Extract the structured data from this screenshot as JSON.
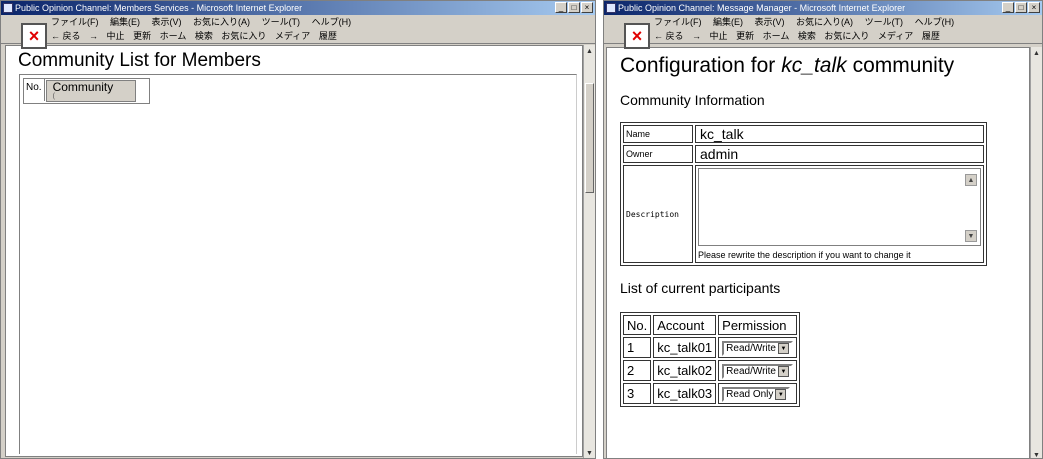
{
  "left_window": {
    "title": "Public Opinion Channel: Members Services - Microsoft Internet Explorer",
    "controls": [
      "_",
      "□",
      "×"
    ],
    "menu": [
      "ファイル(F)",
      "編集(E)",
      "表示(V)",
      "お気に入り(A)",
      "ツール(T)",
      "ヘルプ(H)"
    ],
    "toolbar": [
      "← 戻る",
      "→",
      "中止",
      "更新",
      "ホーム",
      "検索",
      "お気に入り",
      "メディア",
      "履歴"
    ],
    "page_title": "Community List for Members",
    "table": {
      "headers": [
        "No.",
        "Community"
      ],
      "sort_hint": "("
    }
  },
  "right_window": {
    "title": "Public Opinion Channel: Message Manager - Microsoft Internet Explorer",
    "controls": [
      "_",
      "□",
      "×"
    ],
    "menu": [
      "ファイル(F)",
      "編集(E)",
      "表示(V)",
      "お気に入り(A)",
      "ツール(T)",
      "ヘルプ(H)"
    ],
    "toolbar": [
      "← 戻る",
      "→",
      "中止",
      "更新",
      "ホーム",
      "検索",
      "お気に入り",
      "メディア",
      "履歴"
    ],
    "page_title_prefix": "Configuration for",
    "page_title_name": "kc_talk",
    "page_title_suffix": "community",
    "community_info_heading": "Community Information",
    "info": {
      "name_label": "Name",
      "name_value": "kc_talk",
      "owner_label": "Owner",
      "owner_value": "admin",
      "description_label": "Description",
      "description_value": "",
      "description_hint": "Please rewrite the description if you want to change it"
    },
    "participants_heading": "List of current participants",
    "participants": {
      "headers": [
        "No.",
        "Account",
        "Permission"
      ],
      "rows": [
        {
          "no": "1",
          "account": "kc_talk01",
          "permission": "Read/Write"
        },
        {
          "no": "2",
          "account": "kc_talk02",
          "permission": "Read/Write"
        },
        {
          "no": "3",
          "account": "kc_talk03",
          "permission": "Read Only"
        }
      ]
    }
  },
  "broken_image_glyph": "×",
  "colors": {
    "titlebar_start": "#0a246a",
    "titlebar_end": "#a6caf0",
    "window_face": "#d4d0c8",
    "broken_x": "#e00000"
  }
}
